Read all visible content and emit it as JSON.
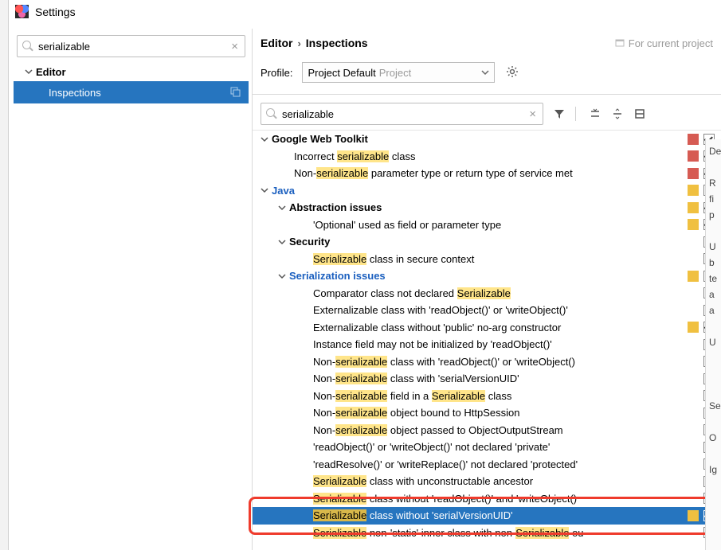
{
  "window": {
    "title": "Settings"
  },
  "sidebar": {
    "search_value": "serializable",
    "root_label": "Editor",
    "child_label": "Inspections"
  },
  "header": {
    "crumb1": "Editor",
    "crumb2": "Inspections",
    "for_project": "For current project",
    "profile_label": "Profile:",
    "profile_value": "Project Default",
    "profile_scope": "Project"
  },
  "insp": {
    "search_value": "serializable"
  },
  "tree": [
    {
      "ind": 0,
      "chev": true,
      "bold": true,
      "parts": [
        [
          "Google Web Toolkit",
          0
        ]
      ],
      "sev": "red",
      "cb": "on"
    },
    {
      "ind": 2,
      "parts": [
        [
          "Incorrect ",
          0
        ],
        [
          "serializable",
          1
        ],
        [
          " class",
          0
        ]
      ],
      "sev": "red",
      "cb": "on"
    },
    {
      "ind": 2,
      "parts": [
        [
          "Non-",
          0
        ],
        [
          "serializable",
          1
        ],
        [
          " parameter type or return type of service met",
          0
        ]
      ],
      "sev": "red",
      "cb": "on"
    },
    {
      "ind": 0,
      "chev": true,
      "bold": true,
      "link": true,
      "parts": [
        [
          "Java",
          0
        ]
      ],
      "sev": "yel",
      "cb": "mixed"
    },
    {
      "ind": 1,
      "chev": true,
      "bold": true,
      "parts": [
        [
          "Abstraction issues",
          0
        ]
      ],
      "sev": "yel",
      "cb": "on"
    },
    {
      "ind": 3,
      "parts": [
        [
          "'Optional' used as field or parameter type",
          0
        ]
      ],
      "sev": "yel",
      "cb": "on"
    },
    {
      "ind": 1,
      "chev": true,
      "bold": true,
      "parts": [
        [
          "Security",
          0
        ]
      ],
      "sev": "",
      "cb": "off"
    },
    {
      "ind": 3,
      "parts": [
        [
          "Serializable",
          1
        ],
        [
          " class in secure context",
          0
        ]
      ],
      "sev": "",
      "cb": "off"
    },
    {
      "ind": 1,
      "chev": true,
      "bold": true,
      "link": true,
      "parts": [
        [
          "Serialization issues",
          0
        ]
      ],
      "sev": "yel",
      "cb": "mixed"
    },
    {
      "ind": 3,
      "parts": [
        [
          "Comparator class not declared ",
          0
        ],
        [
          "Serializable",
          1
        ]
      ],
      "sev": "",
      "cb": "off"
    },
    {
      "ind": 3,
      "parts": [
        [
          "Externalizable class with 'readObject()' or 'writeObject()'",
          0
        ]
      ],
      "sev": "",
      "cb": "off"
    },
    {
      "ind": 3,
      "parts": [
        [
          "Externalizable class without 'public' no-arg constructor",
          0
        ]
      ],
      "sev": "yel",
      "cb": "on"
    },
    {
      "ind": 3,
      "parts": [
        [
          "Instance field may not be initialized by 'readObject()'",
          0
        ]
      ],
      "sev": "",
      "cb": "off"
    },
    {
      "ind": 3,
      "parts": [
        [
          "Non-",
          0
        ],
        [
          "serializable",
          1
        ],
        [
          " class with 'readObject()' or 'writeObject()",
          0
        ]
      ],
      "sev": "",
      "cb": "off"
    },
    {
      "ind": 3,
      "parts": [
        [
          "Non-",
          0
        ],
        [
          "serializable",
          1
        ],
        [
          " class with 'serialVersionUID'",
          0
        ]
      ],
      "sev": "",
      "cb": "off"
    },
    {
      "ind": 3,
      "parts": [
        [
          "Non-",
          0
        ],
        [
          "serializable",
          1
        ],
        [
          " field in a ",
          0
        ],
        [
          "Serializable",
          1
        ],
        [
          " class",
          0
        ]
      ],
      "sev": "",
      "cb": "off"
    },
    {
      "ind": 3,
      "parts": [
        [
          "Non-",
          0
        ],
        [
          "serializable",
          1
        ],
        [
          " object bound to HttpSession",
          0
        ]
      ],
      "sev": "",
      "cb": "off"
    },
    {
      "ind": 3,
      "parts": [
        [
          "Non-",
          0
        ],
        [
          "serializable",
          1
        ],
        [
          " object passed to ObjectOutputStream",
          0
        ]
      ],
      "sev": "",
      "cb": "off"
    },
    {
      "ind": 3,
      "parts": [
        [
          "'readObject()' or 'writeObject()' not declared 'private'",
          0
        ]
      ],
      "sev": "",
      "cb": "off"
    },
    {
      "ind": 3,
      "parts": [
        [
          "'readResolve()' or 'writeReplace()' not declared 'protected'",
          0
        ]
      ],
      "sev": "",
      "cb": "off"
    },
    {
      "ind": 3,
      "parts": [
        [
          "Serializable",
          1
        ],
        [
          " class with unconstructable ancestor",
          0
        ]
      ],
      "sev": "",
      "cb": "off"
    },
    {
      "ind": 3,
      "parts": [
        [
          "Serializable",
          1
        ],
        [
          " class without 'readObject()' and 'writeObject()",
          0
        ]
      ],
      "sev": "",
      "cb": "off"
    },
    {
      "ind": 3,
      "selected": true,
      "parts": [
        [
          "Serializable",
          1
        ],
        [
          " class without 'serialVersionUID'",
          0
        ]
      ],
      "sev": "yel",
      "cb": "on"
    },
    {
      "ind": 3,
      "parts": [
        [
          "Serializable",
          1
        ],
        [
          " non-'static' inner class with non-",
          0
        ],
        [
          "Serializable",
          1
        ],
        [
          " ou",
          0
        ]
      ],
      "sev": "",
      "cb": "off"
    }
  ],
  "rpanel": [
    "De",
    "",
    "R",
    "fi",
    "p",
    "",
    "U",
    "b",
    "te",
    "a",
    "a",
    "",
    "U",
    "",
    "",
    "",
    "Se",
    "",
    "O",
    "",
    "Ig"
  ]
}
